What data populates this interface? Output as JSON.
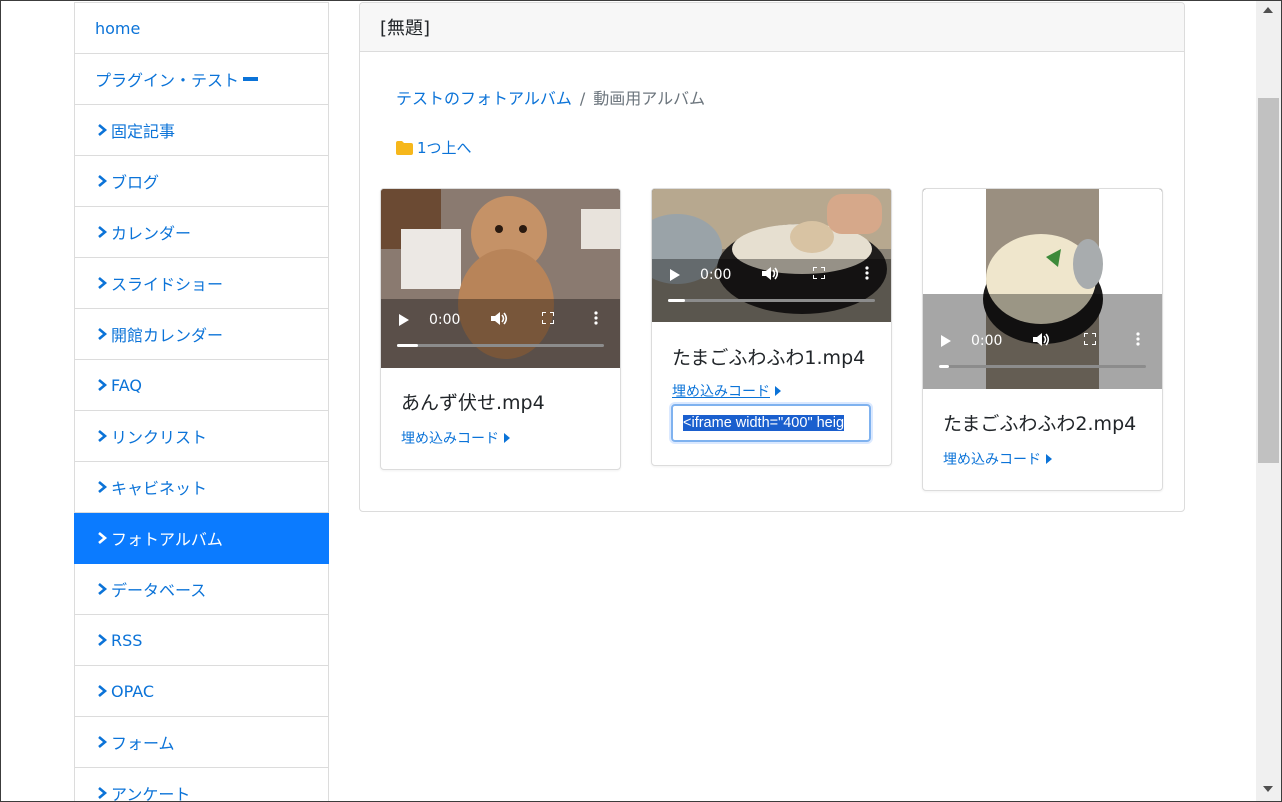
{
  "sidebar": {
    "items": [
      {
        "label": "home"
      },
      {
        "label": "プラグイン・テスト"
      },
      {
        "label": "固定記事"
      },
      {
        "label": "ブログ"
      },
      {
        "label": "カレンダー"
      },
      {
        "label": "スライドショー"
      },
      {
        "label": "開館カレンダー"
      },
      {
        "label": "FAQ"
      },
      {
        "label": "リンクリスト"
      },
      {
        "label": "キャビネット"
      },
      {
        "label": "フォトアルバム"
      },
      {
        "label": "データベース"
      },
      {
        "label": "RSS"
      },
      {
        "label": "OPAC"
      },
      {
        "label": "フォーム"
      },
      {
        "label": "アンケート"
      }
    ]
  },
  "panel": {
    "title": "[無題]",
    "breadcrumb": {
      "parent": "テストのフォトアルバム",
      "separator": "/",
      "current": "動画用アルバム"
    },
    "up_link": "1つ上へ"
  },
  "cards": [
    {
      "title": "あんず伏せ.mp4",
      "time": "0:00",
      "embed_label": "埋め込みコード",
      "progress": 0.1
    },
    {
      "title": "たまごふわふわ1.mp4",
      "time": "0:00",
      "embed_label": "埋め込みコード",
      "embed_code": "<iframe width=\"400\" heig",
      "progress": 0.08
    },
    {
      "title": "たまごふわふわ2.mp4",
      "time": "0:00",
      "embed_label": "埋め込みコード",
      "progress": 0.05
    }
  ],
  "colors": {
    "accent": "#0b7bff",
    "link": "#0b73d8",
    "folder": "#f6b71b"
  }
}
